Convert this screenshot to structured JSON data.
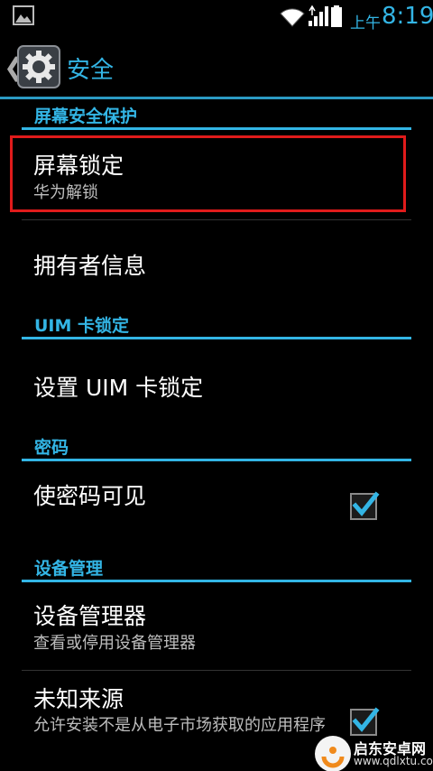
{
  "status_bar": {
    "ampm": "上午",
    "time": "8:19"
  },
  "header": {
    "title": "安全"
  },
  "sections": {
    "screen_security": {
      "header": "屏幕安全保护",
      "screen_lock_title": "屏幕锁定",
      "screen_lock_summary": "华为解锁",
      "owner_info_title": "拥有者信息"
    },
    "uim_lock": {
      "header": "UIM 卡锁定",
      "setup_title": "设置 UIM 卡锁定"
    },
    "password": {
      "header": "密码",
      "show_password_title": "使密码可见",
      "show_password_checked": true
    },
    "device_admin": {
      "header": "设备管理",
      "admins_title": "设备管理器",
      "admins_summary": "查看或停用设备管理器",
      "unknown_sources_title": "未知来源",
      "unknown_sources_summary": "允许安装不是从电子市场获取的应用程序",
      "unknown_sources_checked": true
    }
  },
  "watermark": {
    "name": "启东安卓网",
    "url": "www.qdlxtu.com"
  },
  "colors": {
    "accent": "#33b5e5",
    "highlight": "#e01b1b",
    "background": "#000000"
  }
}
